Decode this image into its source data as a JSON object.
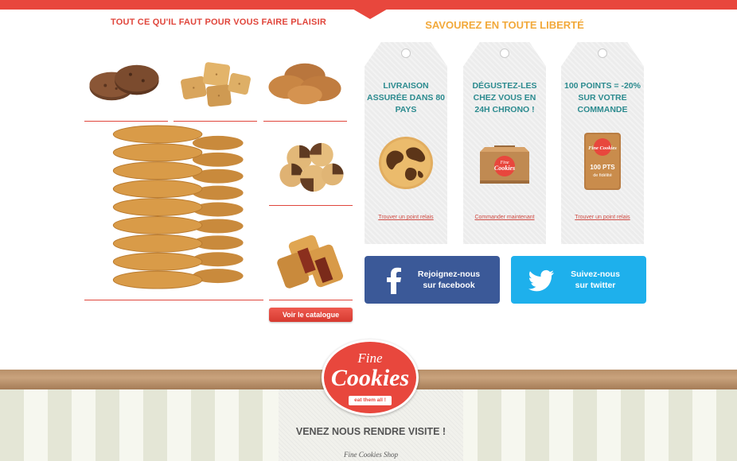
{
  "header": {
    "left_title": "TOUT CE QU'IL FAUT POUR VOUS FAIRE PLAISIR",
    "right_title": "SAVOUREZ EN TOUTE LIBERTÉ"
  },
  "catalog": {
    "button_label": "Voir le catalogue"
  },
  "tags": [
    {
      "text": "LIVRAISON ASSURÉE DANS 80 PAYS",
      "link": "Trouver un point relais",
      "icon": "world-cookie-icon"
    },
    {
      "text": "DÉGUSTEZ-LES CHEZ VOUS EN 24H CHRONO !",
      "link": "Commander maintenant",
      "icon": "delivery-box-icon"
    },
    {
      "text": "100 POINTS = -20% SUR VOTRE COMMANDE",
      "link": "Trouver un point relais",
      "icon": "loyalty-card-icon"
    }
  ],
  "loyalty_card": {
    "brand": "Fine Cookies",
    "points": "100 PTS",
    "caption": "de fidélité"
  },
  "box_brand": {
    "line1": "Fine",
    "line2": "Cookies"
  },
  "social": {
    "facebook": {
      "line1": "Rejoignez-nous",
      "line2": "sur facebook",
      "color": "#3b5998"
    },
    "twitter": {
      "line1": "Suivez-nous",
      "line2": "sur twitter",
      "color": "#1eb0ec"
    }
  },
  "logo": {
    "fine": "Fine",
    "cookies": "Cookies",
    "tagline": "eat them all !"
  },
  "footer": {
    "visit_title": "VENEZ NOUS RENDRE VISITE !",
    "shop_name": "Fine Cookies Shop"
  },
  "colors": {
    "accent": "#e8473d",
    "gold": "#f2a93b",
    "teal": "#2c8b8f"
  }
}
